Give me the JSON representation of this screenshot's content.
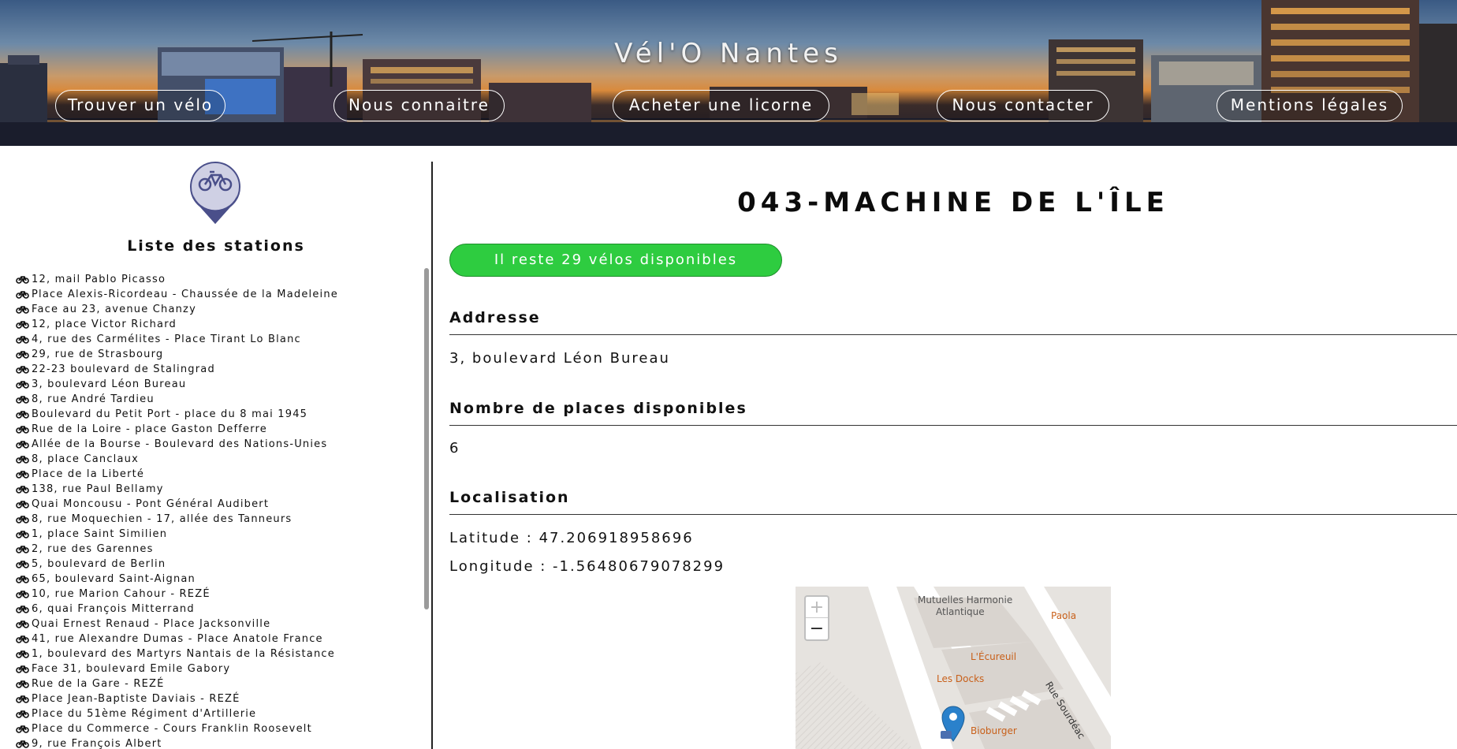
{
  "header": {
    "site_title": "Vél'O Nantes",
    "nav": [
      {
        "label": "Trouver un vélo"
      },
      {
        "label": "Nous connaitre"
      },
      {
        "label": "Acheter une licorne"
      },
      {
        "label": "Nous contacter"
      },
      {
        "label": "Mentions légales"
      }
    ]
  },
  "sidebar": {
    "logo_icon": "bike-pin-icon",
    "heading": "Liste des stations",
    "item_icon": "bike-icon",
    "stations": [
      "12, mail Pablo Picasso",
      "Place Alexis-Ricordeau - Chaussée de la Madeleine",
      "Face au 23, avenue Chanzy",
      "12, place Victor Richard",
      "4, rue des Carmélites - Place Tirant Lo Blanc",
      "29, rue de Strasbourg",
      "22-23 boulevard de Stalingrad",
      "3, boulevard Léon Bureau",
      "8, rue André Tardieu",
      "Boulevard du Petit Port - place du 8 mai 1945",
      "Rue de la Loire - place Gaston Defferre",
      "Allée de la Bourse - Boulevard des Nations-Unies",
      "8, place Canclaux",
      "Place de la Liberté",
      "138, rue Paul Bellamy",
      "Quai Moncousu - Pont Général Audibert",
      "8, rue Moquechien - 17, allée des Tanneurs",
      "1, place Saint Similien",
      "2, rue des Garennes",
      "5, boulevard de Berlin",
      "65, boulevard Saint-Aignan",
      "10, rue Marion Cahour - REZÉ",
      "6, quai François Mitterrand",
      "Quai Ernest Renaud - Place Jacksonville",
      "41, rue Alexandre Dumas - Place Anatole France",
      "1, boulevard des Martyrs Nantais de la Résistance",
      "Face 31, boulevard Emile Gabory",
      "Rue de la Gare - REZÉ",
      "Place Jean-Baptiste Daviais - REZÉ",
      "Place du 51ème Régiment d'Artillerie",
      "Place du Commerce - Cours Franklin Roosevelt",
      "9, rue François Albert"
    ]
  },
  "station": {
    "title": "043-MACHINE DE L'ÎLE",
    "availability": "Il reste 29 vélos disponibles",
    "address_label": "Addresse",
    "address": "3, boulevard Léon Bureau",
    "places_label": "Nombre de places disponibles",
    "places": "6",
    "location_label": "Localisation",
    "latitude": "Latitude : 47.206918958696",
    "longitude": "Longitude : -1.56480679078299"
  },
  "map": {
    "zoom_in": "+",
    "zoom_out": "−",
    "labels": {
      "mutuelles": "Mutuelles Harmonie",
      "atlantique": "Atlantique",
      "paola": "Paola",
      "ecureuil": "L'Écureuil",
      "docks": "Les Docks",
      "bioburger": "Bioburger",
      "street": "Rue Sourdéac"
    },
    "marker_icon": "map-marker-icon",
    "colors": {
      "marker": "#2a81cb",
      "poi": "#c8601a"
    }
  },
  "colors": {
    "availability": "#2ecc40",
    "accent_logo": "#4a4f8a"
  }
}
